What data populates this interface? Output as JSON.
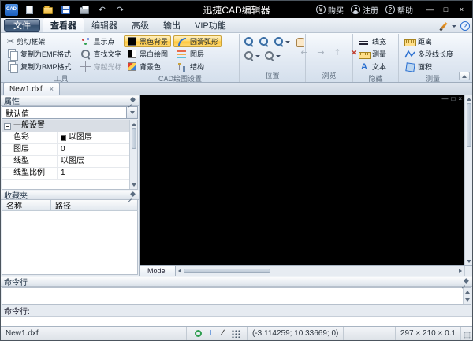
{
  "titlebar": {
    "logo": "CAD",
    "title": "迅捷CAD编辑器",
    "buy": "购买",
    "register": "注册",
    "help": "帮助"
  },
  "icons": {
    "scissors": "✂",
    "undo": "↶",
    "redo": "↷",
    "back": "←",
    "forward": "→",
    "up": "↑",
    "stop": "×",
    "yen": "¥",
    "question": "?",
    "minimize": "—",
    "maximize": "□",
    "close": "×",
    "text_a": "A"
  },
  "tabs": {
    "file": "文件",
    "viewer": "查看器",
    "editor": "编辑器",
    "advanced": "高级",
    "output": "输出",
    "vip": "VIP功能"
  },
  "ribbon": {
    "tools": {
      "caption": "工具",
      "cut_frame": "剪切框架",
      "copy_emf": "复制为EMF格式",
      "copy_bmp": "复制为BMP格式",
      "show_points": "显示点",
      "find_text": "查找文字",
      "cross_cursor": "穿越光标"
    },
    "draw_settings": {
      "caption": "CAD绘图设置",
      "black_bg": "黑色背景",
      "bw_drawing": "黑白绘图",
      "bg_color": "背景色",
      "smooth_arc": "圆滑弧形",
      "layers": "图层",
      "structure": "结构"
    },
    "position": {
      "caption": "位置"
    },
    "browse": {
      "caption": "浏览"
    },
    "hide": {
      "caption": "隐藏",
      "line_width": "线宽",
      "measure": "测量",
      "text": "文本"
    },
    "measure": {
      "caption": "测量",
      "distance": "距离",
      "polyline_length": "多段线长度",
      "area": "面积"
    }
  },
  "document": {
    "tab_label": "New1.dxf",
    "model_label": "Model"
  },
  "props": {
    "title": "属性",
    "preset": "默认值",
    "group_label": "一般设置",
    "rows": [
      {
        "label": "色彩",
        "value": "以图层"
      },
      {
        "label": "图层",
        "value": "0"
      },
      {
        "label": "线型",
        "value": "以图层"
      },
      {
        "label": "线型比例",
        "value": "1"
      }
    ]
  },
  "favorites": {
    "title": "收藏夹",
    "name_col": "名称",
    "path_col": "路径"
  },
  "command": {
    "title": "命令行",
    "prompt": "命令行:",
    "input_value": ""
  },
  "status": {
    "file": "New1.dxf",
    "coords": "(-3.114259; 10.33669; 0)",
    "dims": "297 × 210 × 0.1"
  },
  "colors": {
    "highlight": "#ffd25e",
    "titlebar_bg": "#000000",
    "canvas_bg": "#000000",
    "accent": "#2a6fd0"
  }
}
